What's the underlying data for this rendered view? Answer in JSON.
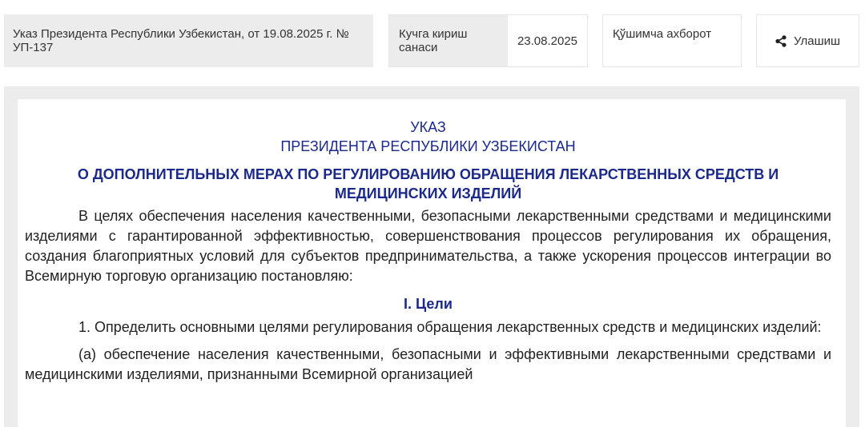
{
  "header": {
    "doc_reference": "Указ Президента Республики Узбекистан, от 19.08.2025 г. № УП-137",
    "effective_date_label": "Кучга кириш санаси",
    "effective_date_value": "23.08.2025",
    "extra_info_label": "Қўшимча ахборот",
    "share_label": "Улашиш",
    "share_icon": "share-icon"
  },
  "document": {
    "type": "УКАЗ",
    "issuer": "ПРЕЗИДЕНТА РЕСПУБЛИКИ УЗБЕКИСТАН",
    "title": "О ДОПОЛНИТЕЛЬНЫХ МЕРАХ ПО РЕГУЛИРОВАНИЮ ОБРАЩЕНИЯ ЛЕКАРСТВЕННЫХ СРЕДСТВ И МЕДИЦИНСКИХ ИЗДЕЛИЙ",
    "intro": "В целях обеспечения населения качественными, безопасными лекарственными средствами и медицинскими изделиями с гарантированной эффективностью, совершенствования процессов регулирования их обращения, создания благоприятных условий для субъектов предпринимательства, а также ускорения процессов интеграции во Всемирную торговую организацию постановляю:",
    "section_1_heading": "I. Цели",
    "item_1": "1. Определить основными целями регулирования обращения лекарственных средств и медицинских изделий:",
    "item_1a": "(а) обеспечение населения качественными, безопасными и эффективными лекарственными средствами и медицинскими изделиями, признанными Всемирной организацией"
  },
  "colors": {
    "heading_blue": "#1b2a8a",
    "panel_gray": "#ececec"
  }
}
